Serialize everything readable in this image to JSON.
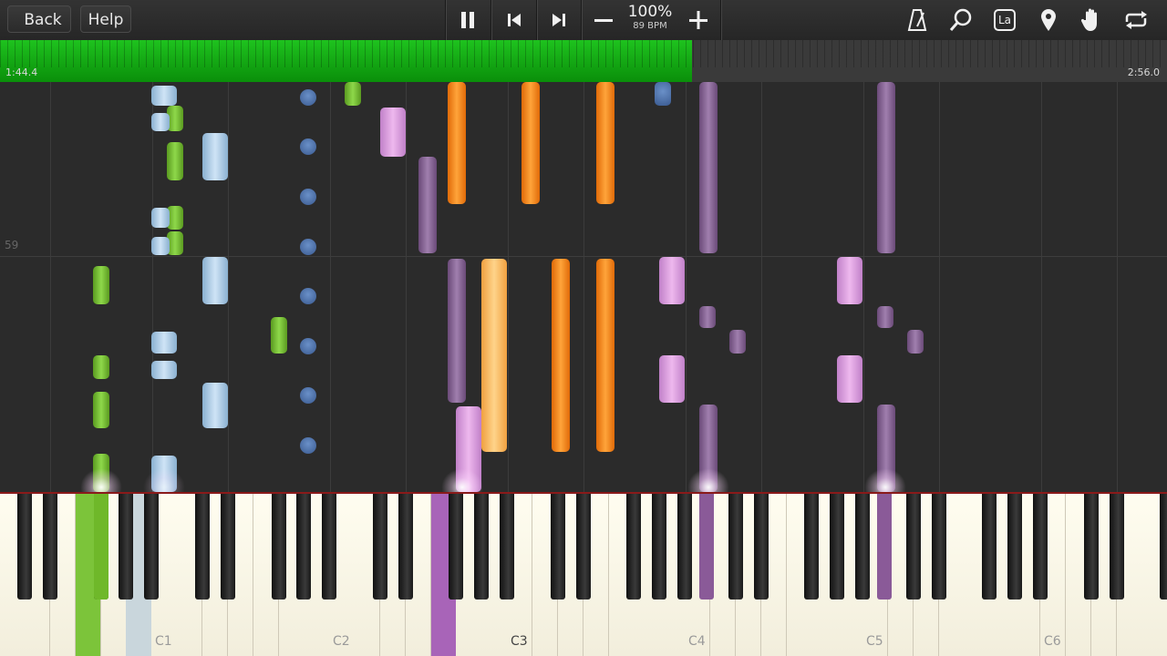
{
  "toolbar": {
    "back_label": "Back",
    "help_label": "Help",
    "zoom": "100%",
    "bpm": "89 BPM",
    "icons": [
      "pause-icon",
      "skip-back-icon",
      "skip-forward-icon",
      "minus-icon",
      "plus-icon",
      "metronome-icon",
      "search-icon",
      "note-label-icon",
      "location-pin-icon",
      "hand-icon",
      "loop-icon"
    ],
    "note_label_text": "La"
  },
  "progress": {
    "elapsed": "1:44.4",
    "total": "2:56.0",
    "fraction": 0.593
  },
  "roll": {
    "measure_number": "59"
  },
  "keyboard": {
    "octave_labels": [
      "C1",
      "C2",
      "C3",
      "C4",
      "C5",
      "C6"
    ],
    "active_label": "C3"
  },
  "colors": {
    "progress": "#18b518",
    "green_note": "#7ccf35",
    "light_blue_note": "#b6d4ee",
    "dark_blue_note": "#4a70a8",
    "purple_note": "#8b6a9a",
    "pink_note": "#dda3e0",
    "orange_note": "#f88a1e",
    "light_orange_note": "#ffc060"
  }
}
